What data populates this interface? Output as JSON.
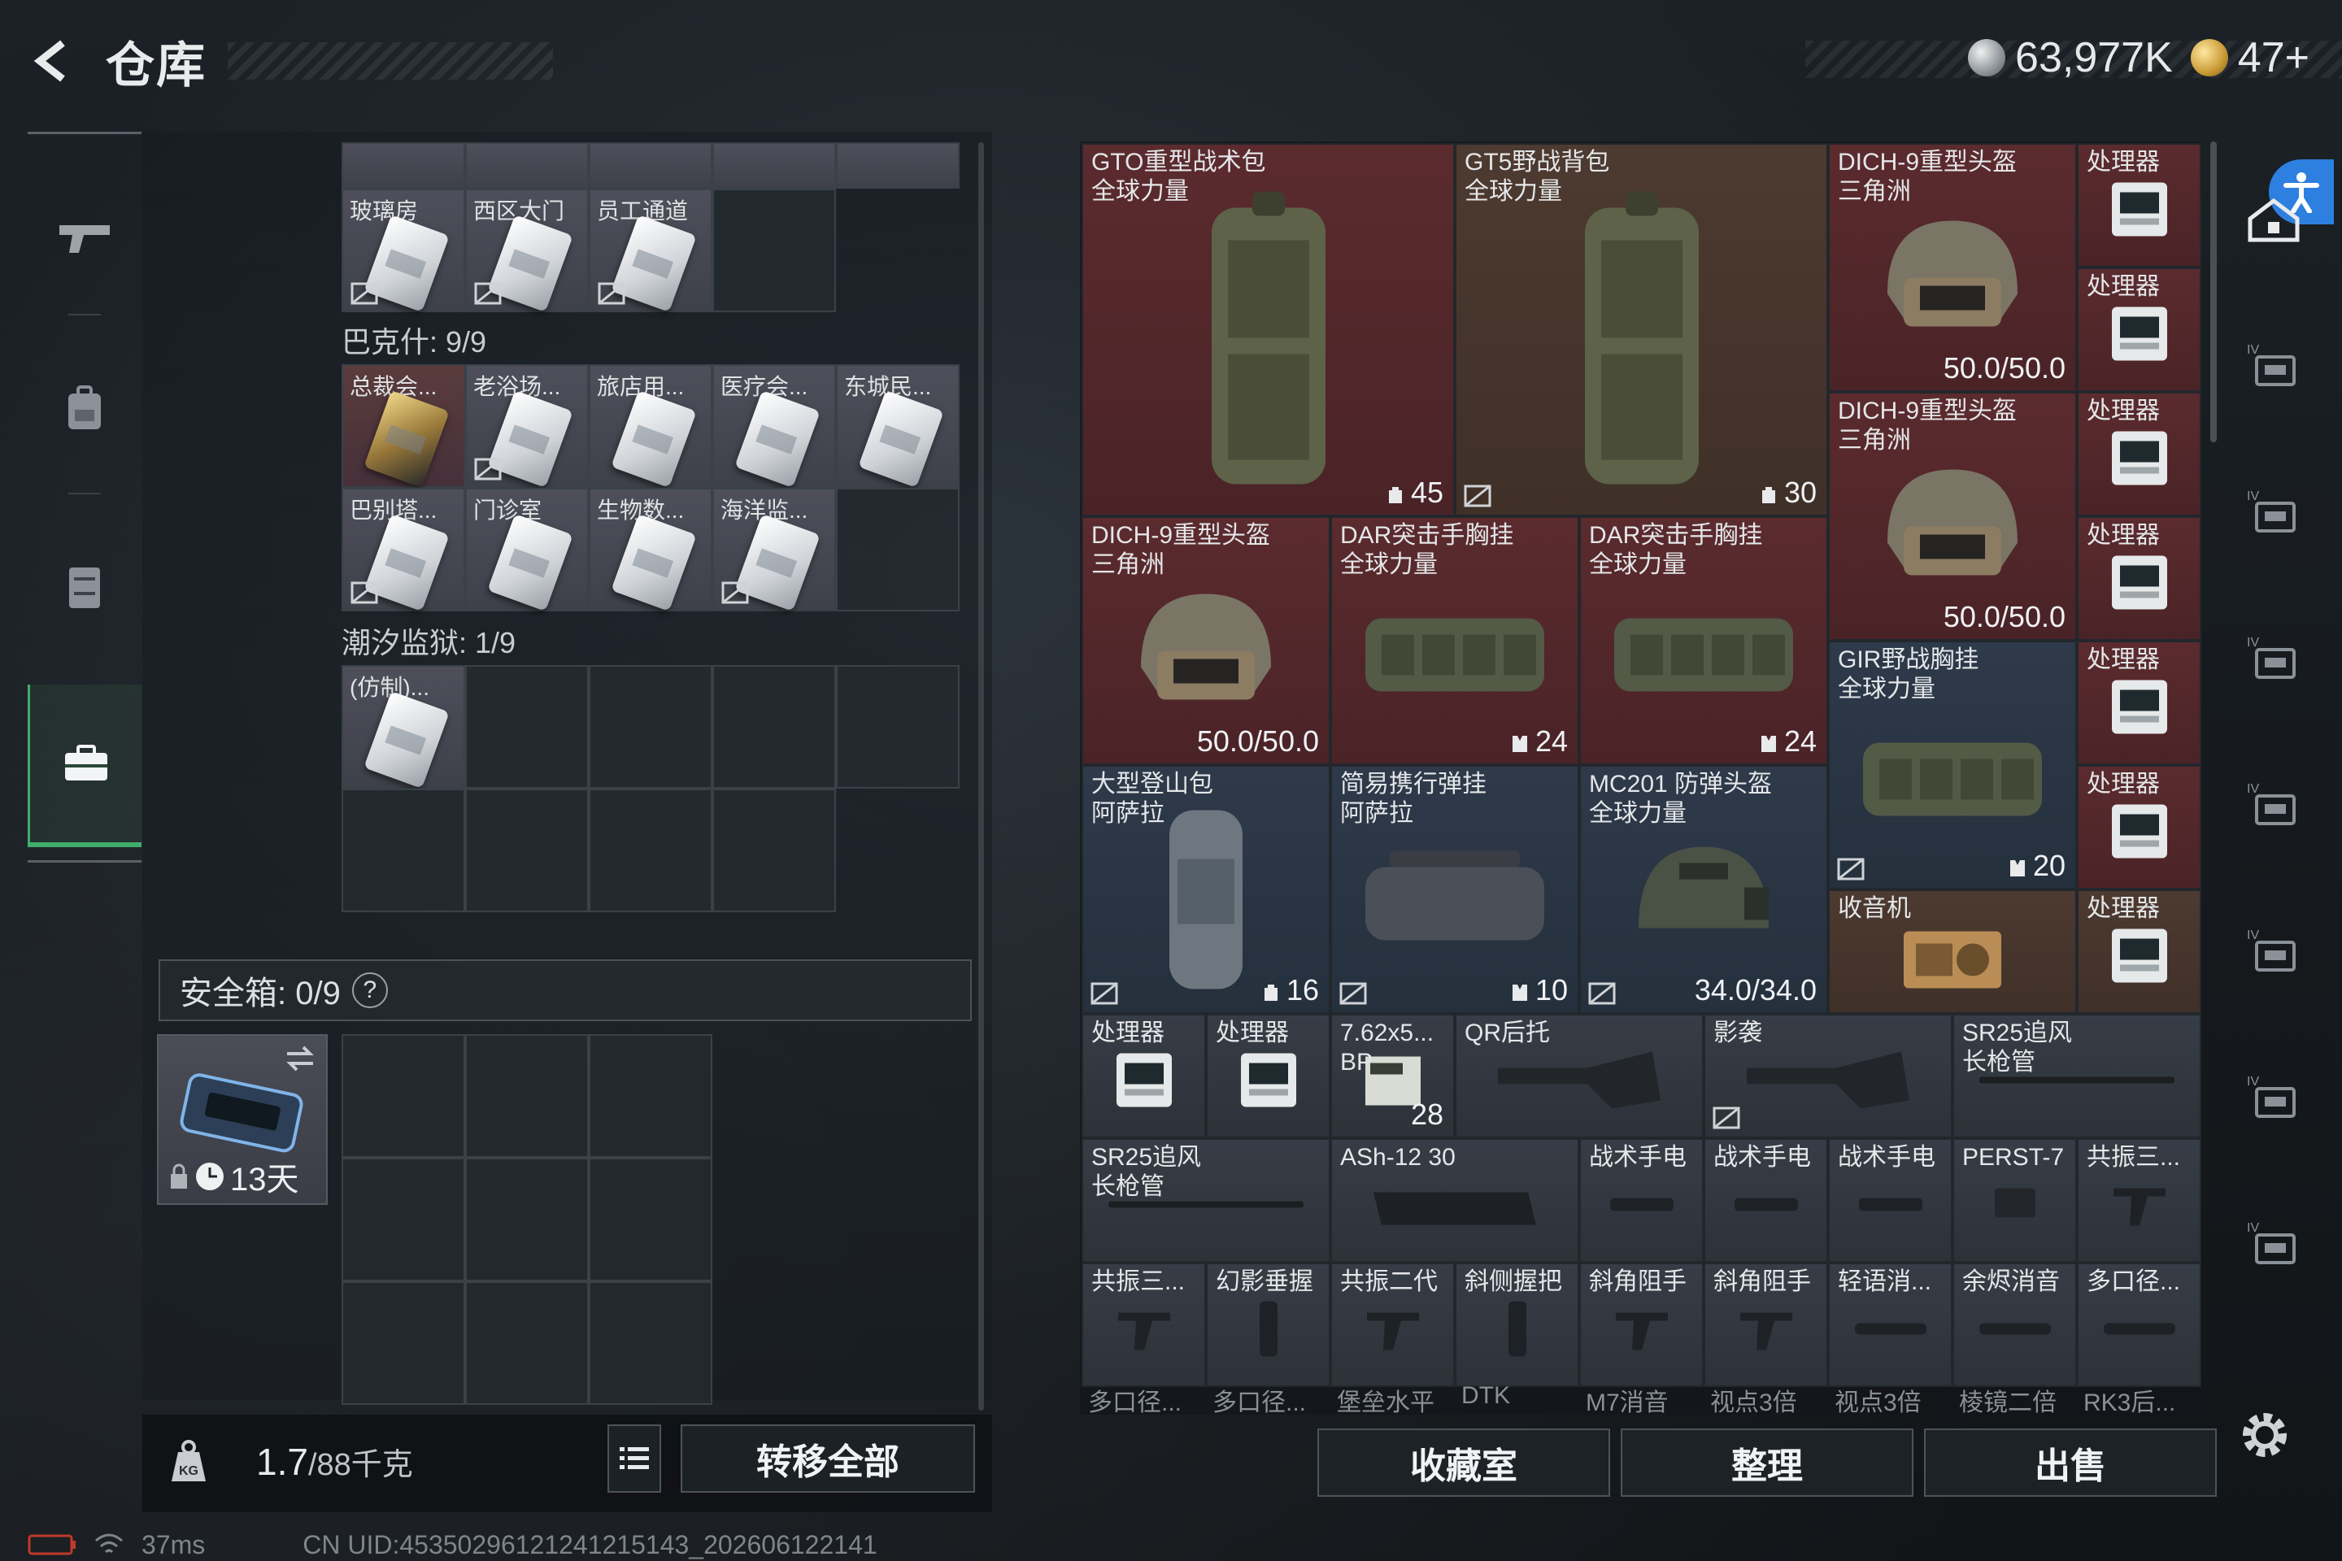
{
  "header": {
    "title": "仓库",
    "currency_silver": "63,977K",
    "currency_gold": "47+"
  },
  "left_nav": [
    "gun-icon",
    "backpack-icon",
    "locker-icon",
    "toolbox-icon"
  ],
  "keycards": {
    "top_row_labels": [
      "玻璃房",
      "西区大门",
      "员工通道"
    ],
    "section_bakshi": "巴克什: 9/9",
    "bakshi_row1": [
      "总裁会...",
      "老浴场...",
      "旅店用...",
      "医疗会...",
      "东城民..."
    ],
    "bakshi_row2": [
      "巴别塔...",
      "门诊室",
      "生物数...",
      "海洋监..."
    ],
    "section_tide": "潮汐监狱: 1/9",
    "tide_row1": [
      "(仿制)..."
    ]
  },
  "safe_box": {
    "label": "安全箱: 0/9",
    "help": "?",
    "duration": "13天"
  },
  "bottom_left": {
    "weight_value": "1.7",
    "weight_capacity": "/88千克",
    "transfer_all": "转移全部"
  },
  "stash": {
    "items": [
      {
        "key": "gto",
        "name": "GTO重型战术包\n全球力量",
        "num": "45"
      },
      {
        "key": "gt5",
        "name": "GT5野战背包\n全球力量",
        "num": "30"
      },
      {
        "key": "dich1",
        "name": "DICH-9重型头盔\n三角洲",
        "num": "50.0/50.0"
      },
      {
        "key": "dich2",
        "name": "DICH-9重型头盔\n三角洲",
        "num": "50.0/50.0"
      },
      {
        "key": "dich3",
        "name": "DICH-9重型头盔\n三角洲",
        "num": "50.0/50.0"
      },
      {
        "key": "dar1",
        "name": "DAR突击手胸挂\n全球力量",
        "num": "24"
      },
      {
        "key": "dar2",
        "name": "DAR突击手胸挂\n全球力量",
        "num": "24"
      },
      {
        "key": "gir",
        "name": "GIR野战胸挂\n全球力量",
        "num": "20"
      },
      {
        "key": "bigpack",
        "name": "大型登山包\n阿萨拉",
        "num": "16"
      },
      {
        "key": "simple",
        "name": "简易携行弹挂\n阿萨拉",
        "num": "10"
      },
      {
        "key": "mc201",
        "name": "MC201 防弹头盔\n全球力量",
        "num": "34.0/34.0"
      },
      {
        "key": "radio",
        "name": "收音机",
        "num": ""
      },
      {
        "key": "proc",
        "name": "处理器",
        "num": ""
      },
      {
        "key": "ammo",
        "name": "7.62x5...\nBP",
        "num": "28"
      },
      {
        "key": "qr",
        "name": "QR后托",
        "num": ""
      },
      {
        "key": "shadow",
        "name": "影袭",
        "num": ""
      },
      {
        "key": "sr25a",
        "name": "SR25追风\n长枪管",
        "num": ""
      },
      {
        "key": "sr25b",
        "name": "SR25追风\n长枪管",
        "num": ""
      },
      {
        "key": "ash12",
        "name": "ASh-12 30",
        "num": ""
      },
      {
        "key": "flash",
        "name": "战术手电",
        "num": ""
      },
      {
        "key": "perst",
        "name": "PERST-7",
        "num": ""
      },
      {
        "key": "gongzhen",
        "name": "共振三...",
        "num": ""
      },
      {
        "key": "phantom",
        "name": "幻影垂握",
        "num": ""
      },
      {
        "key": "gz2",
        "name": "共振二代",
        "num": ""
      },
      {
        "key": "slant",
        "name": "斜侧握把",
        "num": ""
      },
      {
        "key": "stop",
        "name": "斜角阻手",
        "num": ""
      },
      {
        "key": "light_sup",
        "name": "轻语消...",
        "num": ""
      },
      {
        "key": "ember",
        "name": "余烬消音",
        "num": ""
      },
      {
        "key": "multi",
        "name": "多口径...",
        "num": ""
      }
    ],
    "fade_row": [
      "多口径...",
      "多口径...",
      "堡垒水平",
      "DTK",
      "M7消音",
      "视点3倍",
      "视点3倍",
      "棱镜二倍",
      "RK3后..."
    ]
  },
  "bottom_right": {
    "collection": "收藏室",
    "organize": "整理",
    "sell": "出售"
  },
  "status": {
    "ping": "37ms",
    "uid": "CN UID:45350296121241215143_202606122141"
  },
  "right_nav": [
    "home-lock-icon",
    "tier4-box-icon",
    "tier4-folder-icon",
    "tier4-medkit-icon",
    "tier5-safe-icon",
    "tier4-bag-icon",
    "tier4-case-icon",
    "tier4-card-icon"
  ]
}
